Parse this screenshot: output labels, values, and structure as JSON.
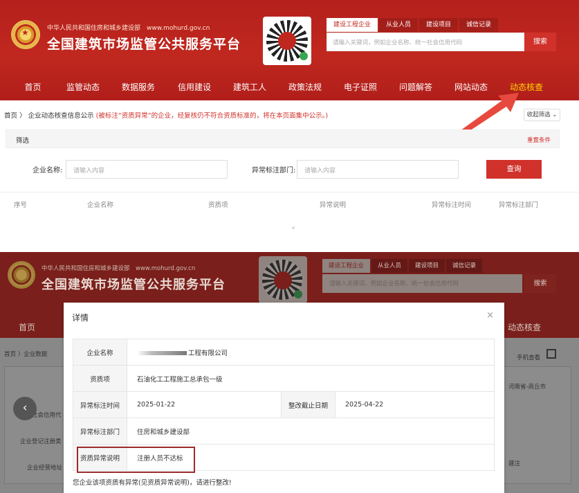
{
  "top": {
    "site_sub": "中华人民共和国住房和城乡建设部　www.mohurd.gov.cn",
    "site_title": "全国建筑市场监管公共服务平台",
    "search_tabs": [
      "建设工程企业",
      "从业人员",
      "建设项目",
      "诚信记录"
    ],
    "search_placeholder": "请输入关键词，例如企业名称、统一社会信用代码",
    "search_button": "搜索",
    "nav": [
      "首页",
      "监管动态",
      "数据服务",
      "信用建设",
      "建筑工人",
      "政策法规",
      "电子证照",
      "问题解答",
      "网站动态",
      "动态核查"
    ],
    "breadcrumb_home": "首页",
    "breadcrumb_current": "企业动态核查信息公示",
    "breadcrumb_notice": "(被标注“资质异常”的企业，经复核仍不符合资质标准的，将在本页面集中公示。)",
    "collapse_button": "收起筛选 ⌄",
    "filter_title": "筛选",
    "filter_reset": "重置条件",
    "company_label": "企业名称:",
    "company_placeholder": "请输入内容",
    "dept_label": "异常标注部门:",
    "dept_placeholder": "请输入内容",
    "query_button": "查询",
    "columns": [
      "序号",
      "企业名称",
      "资质项",
      "异常说明",
      "异常标注时间",
      "异常标注部门"
    ]
  },
  "bottom": {
    "site_sub": "中华人民共和国住房和城乡建设部　www.mohurd.gov.cn",
    "site_title": "全国建筑市场监管公共服务平台",
    "search_tabs": [
      "建设工程企业",
      "从业人员",
      "建设项目",
      "诚信记录"
    ],
    "search_placeholder": "请输入关键词，例如企业名称、统一社会信用代码",
    "search_button": "搜索",
    "nav_first": "首页",
    "nav_last": "动态核查",
    "breadcrumb": "首页 〉企业数据",
    "mobile_view": "手机查看",
    "left_rows": [
      "统一社会信用代",
      "企业登记注册类",
      "企业经营地址"
    ],
    "right_rows": [
      "河南省-商丘市",
      "建注"
    ],
    "modal": {
      "title": "详情",
      "close": "×",
      "rows": {
        "company_label": "企业名称",
        "company_value": "工程有限公司",
        "qual_label": "资质项",
        "qual_value": "石油化工工程施工总承包一级",
        "time_label": "异常标注时间",
        "time_value": "2025-01-22",
        "deadline_label": "整改截止日期",
        "deadline_value": "2025-04-22",
        "dept_label": "异常标注部门",
        "dept_value": "住房和城乡建设部",
        "reason_label": "资质异常说明",
        "reason_value": "注册人员不达标"
      },
      "footer": "您企业该项资质有异常(见资质异常说明)，请进行整改!"
    }
  },
  "colors": {
    "brand_red": "#c0281f",
    "accent_yellow": "#ffd400",
    "highlight_border": "#9b2b2b"
  }
}
